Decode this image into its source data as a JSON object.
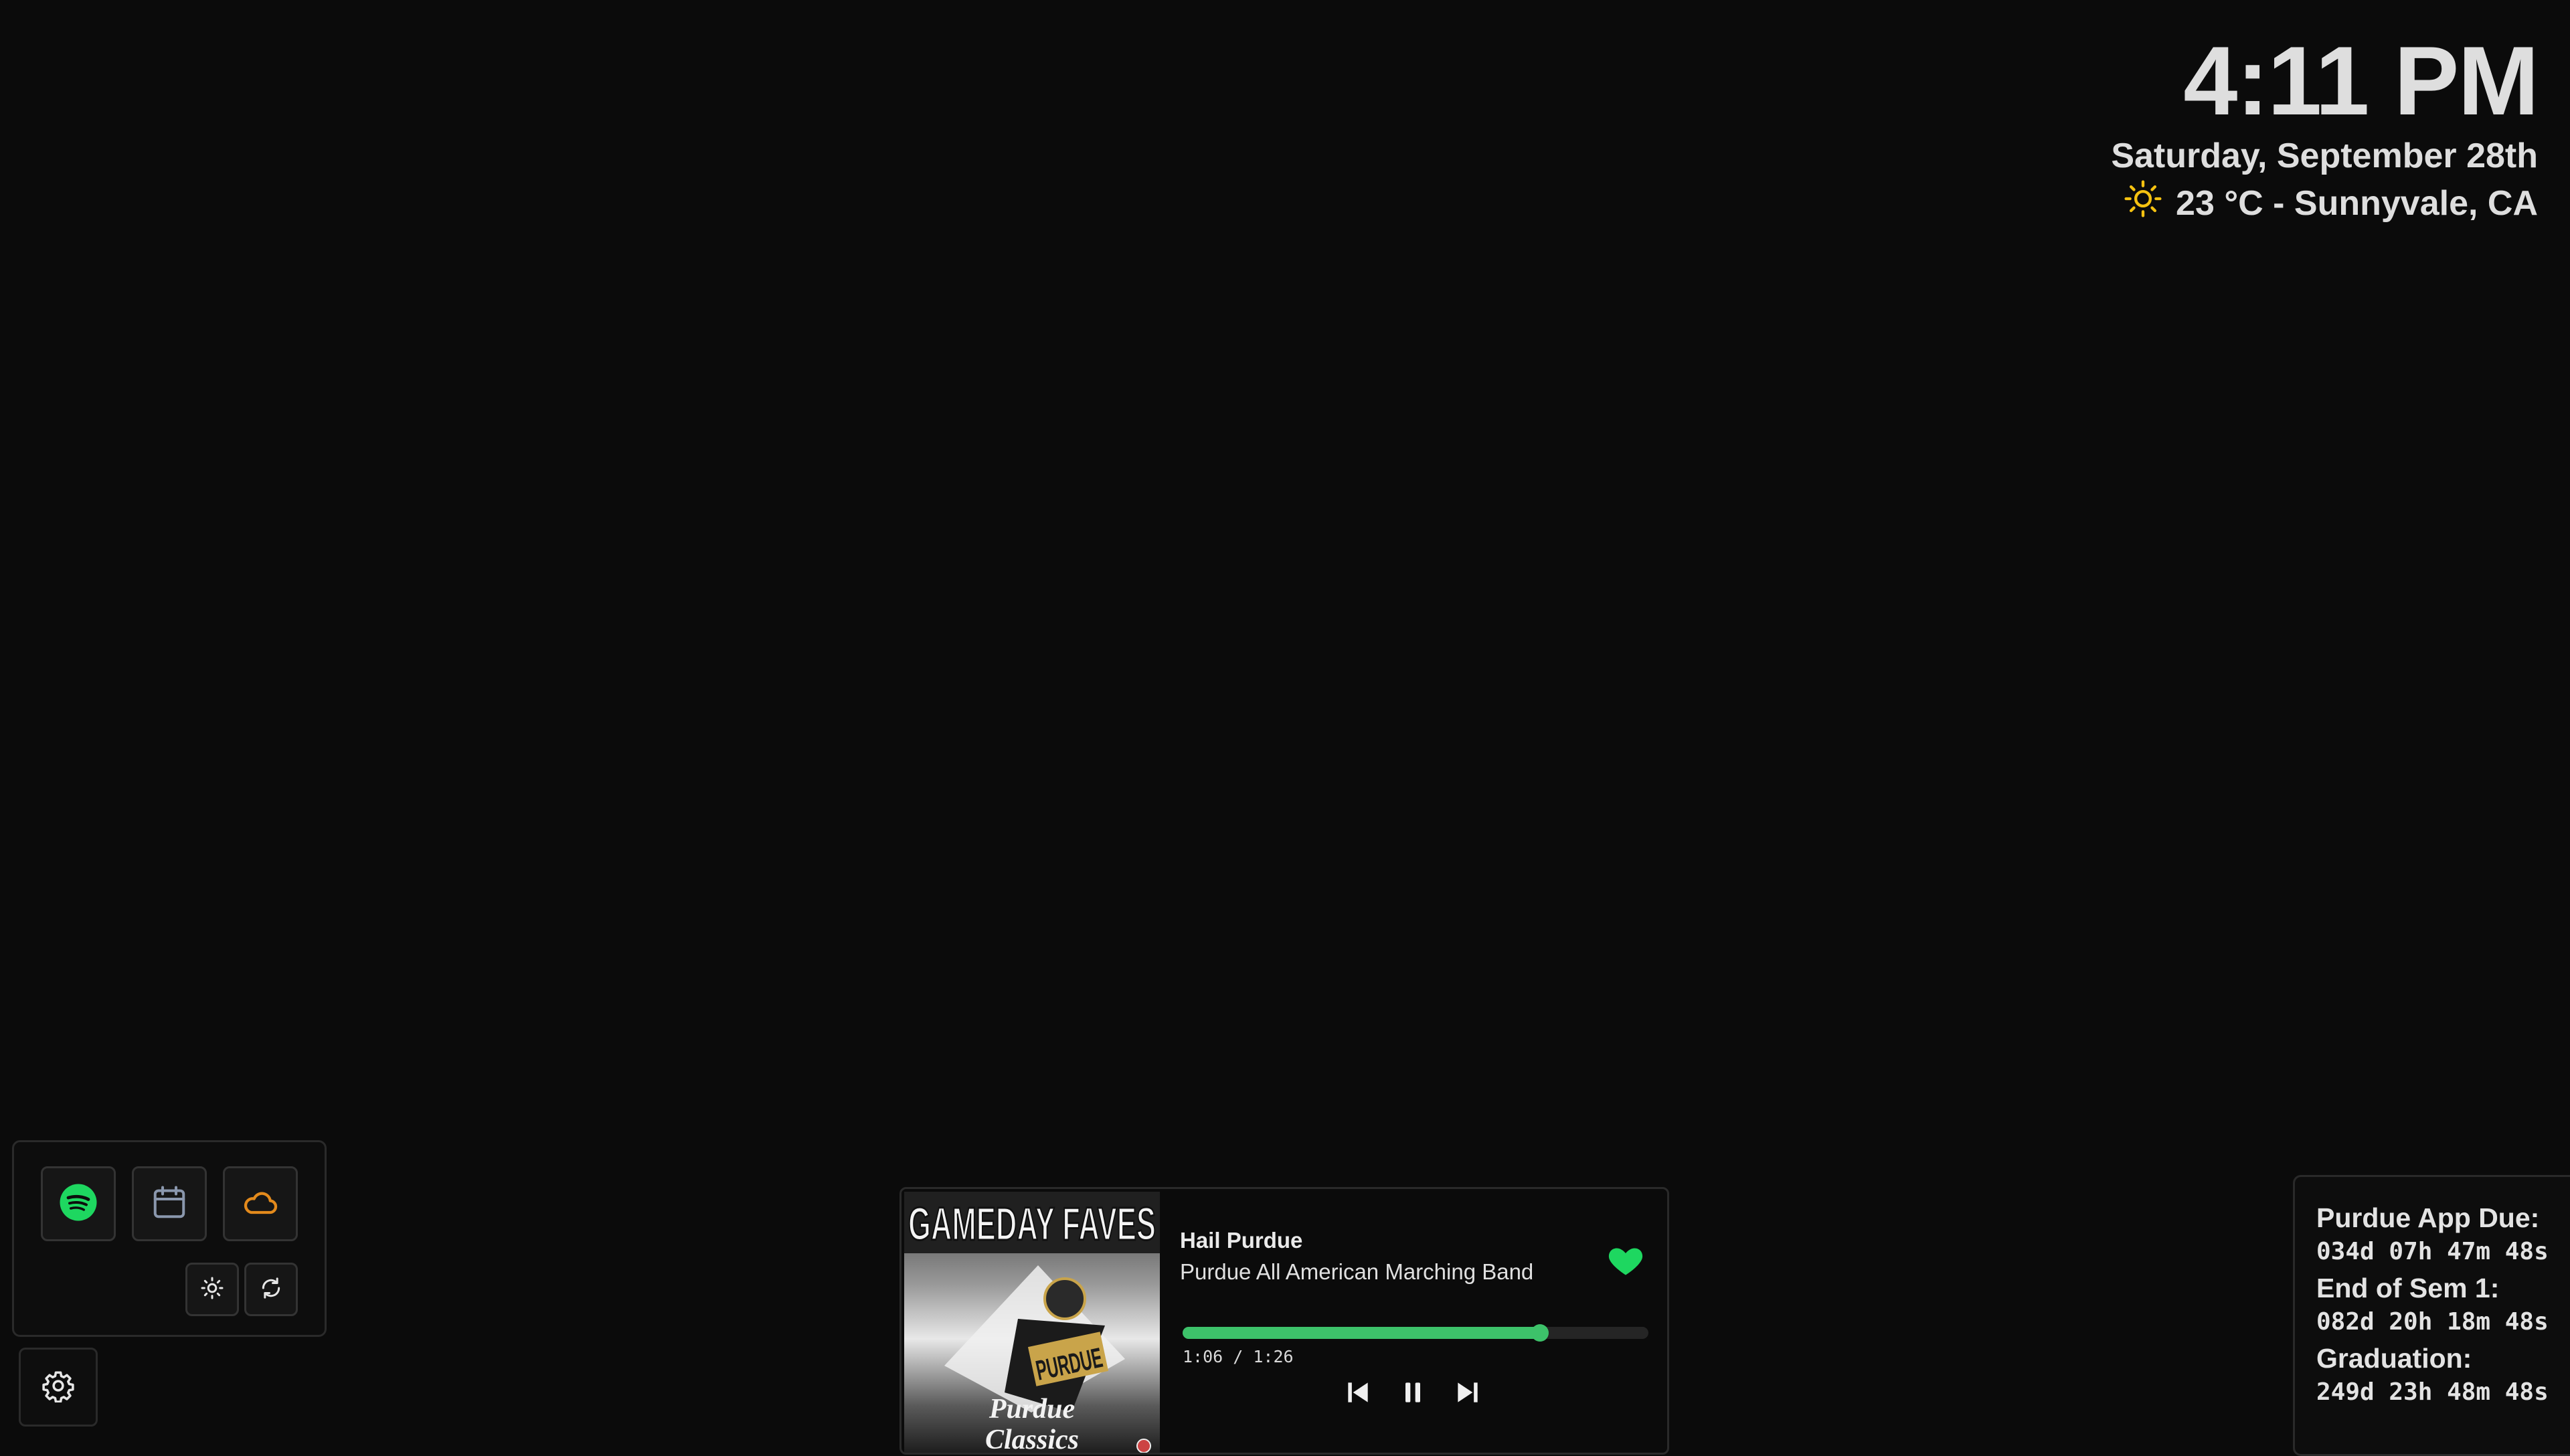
{
  "clock": {
    "time": "4:11 PM",
    "date": "Saturday, September 28th",
    "weather_icon": "sun-icon",
    "weather_text": "23 °C - Sunnyvale, CA"
  },
  "launcher": {
    "apps": [
      {
        "icon": "spotify-icon",
        "color": "#1ed760"
      },
      {
        "icon": "calendar-icon",
        "color": "#8a97ad"
      },
      {
        "icon": "cloud-icon",
        "color": "#e38a1c"
      }
    ],
    "small_buttons": [
      {
        "icon": "brightness-icon"
      },
      {
        "icon": "refresh-icon"
      }
    ]
  },
  "settings": {
    "icon": "gear-icon"
  },
  "player": {
    "album_art_text": "GAMEDAY FAVES",
    "album_art_subtitle_1": "Purdue",
    "album_art_subtitle_2": "Classics",
    "album_art_logo": "PURDUE",
    "track_title": "Hail Purdue",
    "track_artist": "Purdue All American Marching Band",
    "liked": true,
    "accent_color": "#3dc26a",
    "progress_fraction": 0.767,
    "progress_text": "1:06 / 1:26",
    "controls": [
      "previous-icon",
      "pause-icon",
      "next-icon"
    ]
  },
  "countdowns": [
    {
      "label": "Purdue App Due:",
      "value": "034d 07h 47m 48s"
    },
    {
      "label": "End of Sem 1:",
      "value": "082d 20h 18m 48s"
    },
    {
      "label": "Graduation:",
      "value": "249d 23h 48m 48s"
    }
  ]
}
